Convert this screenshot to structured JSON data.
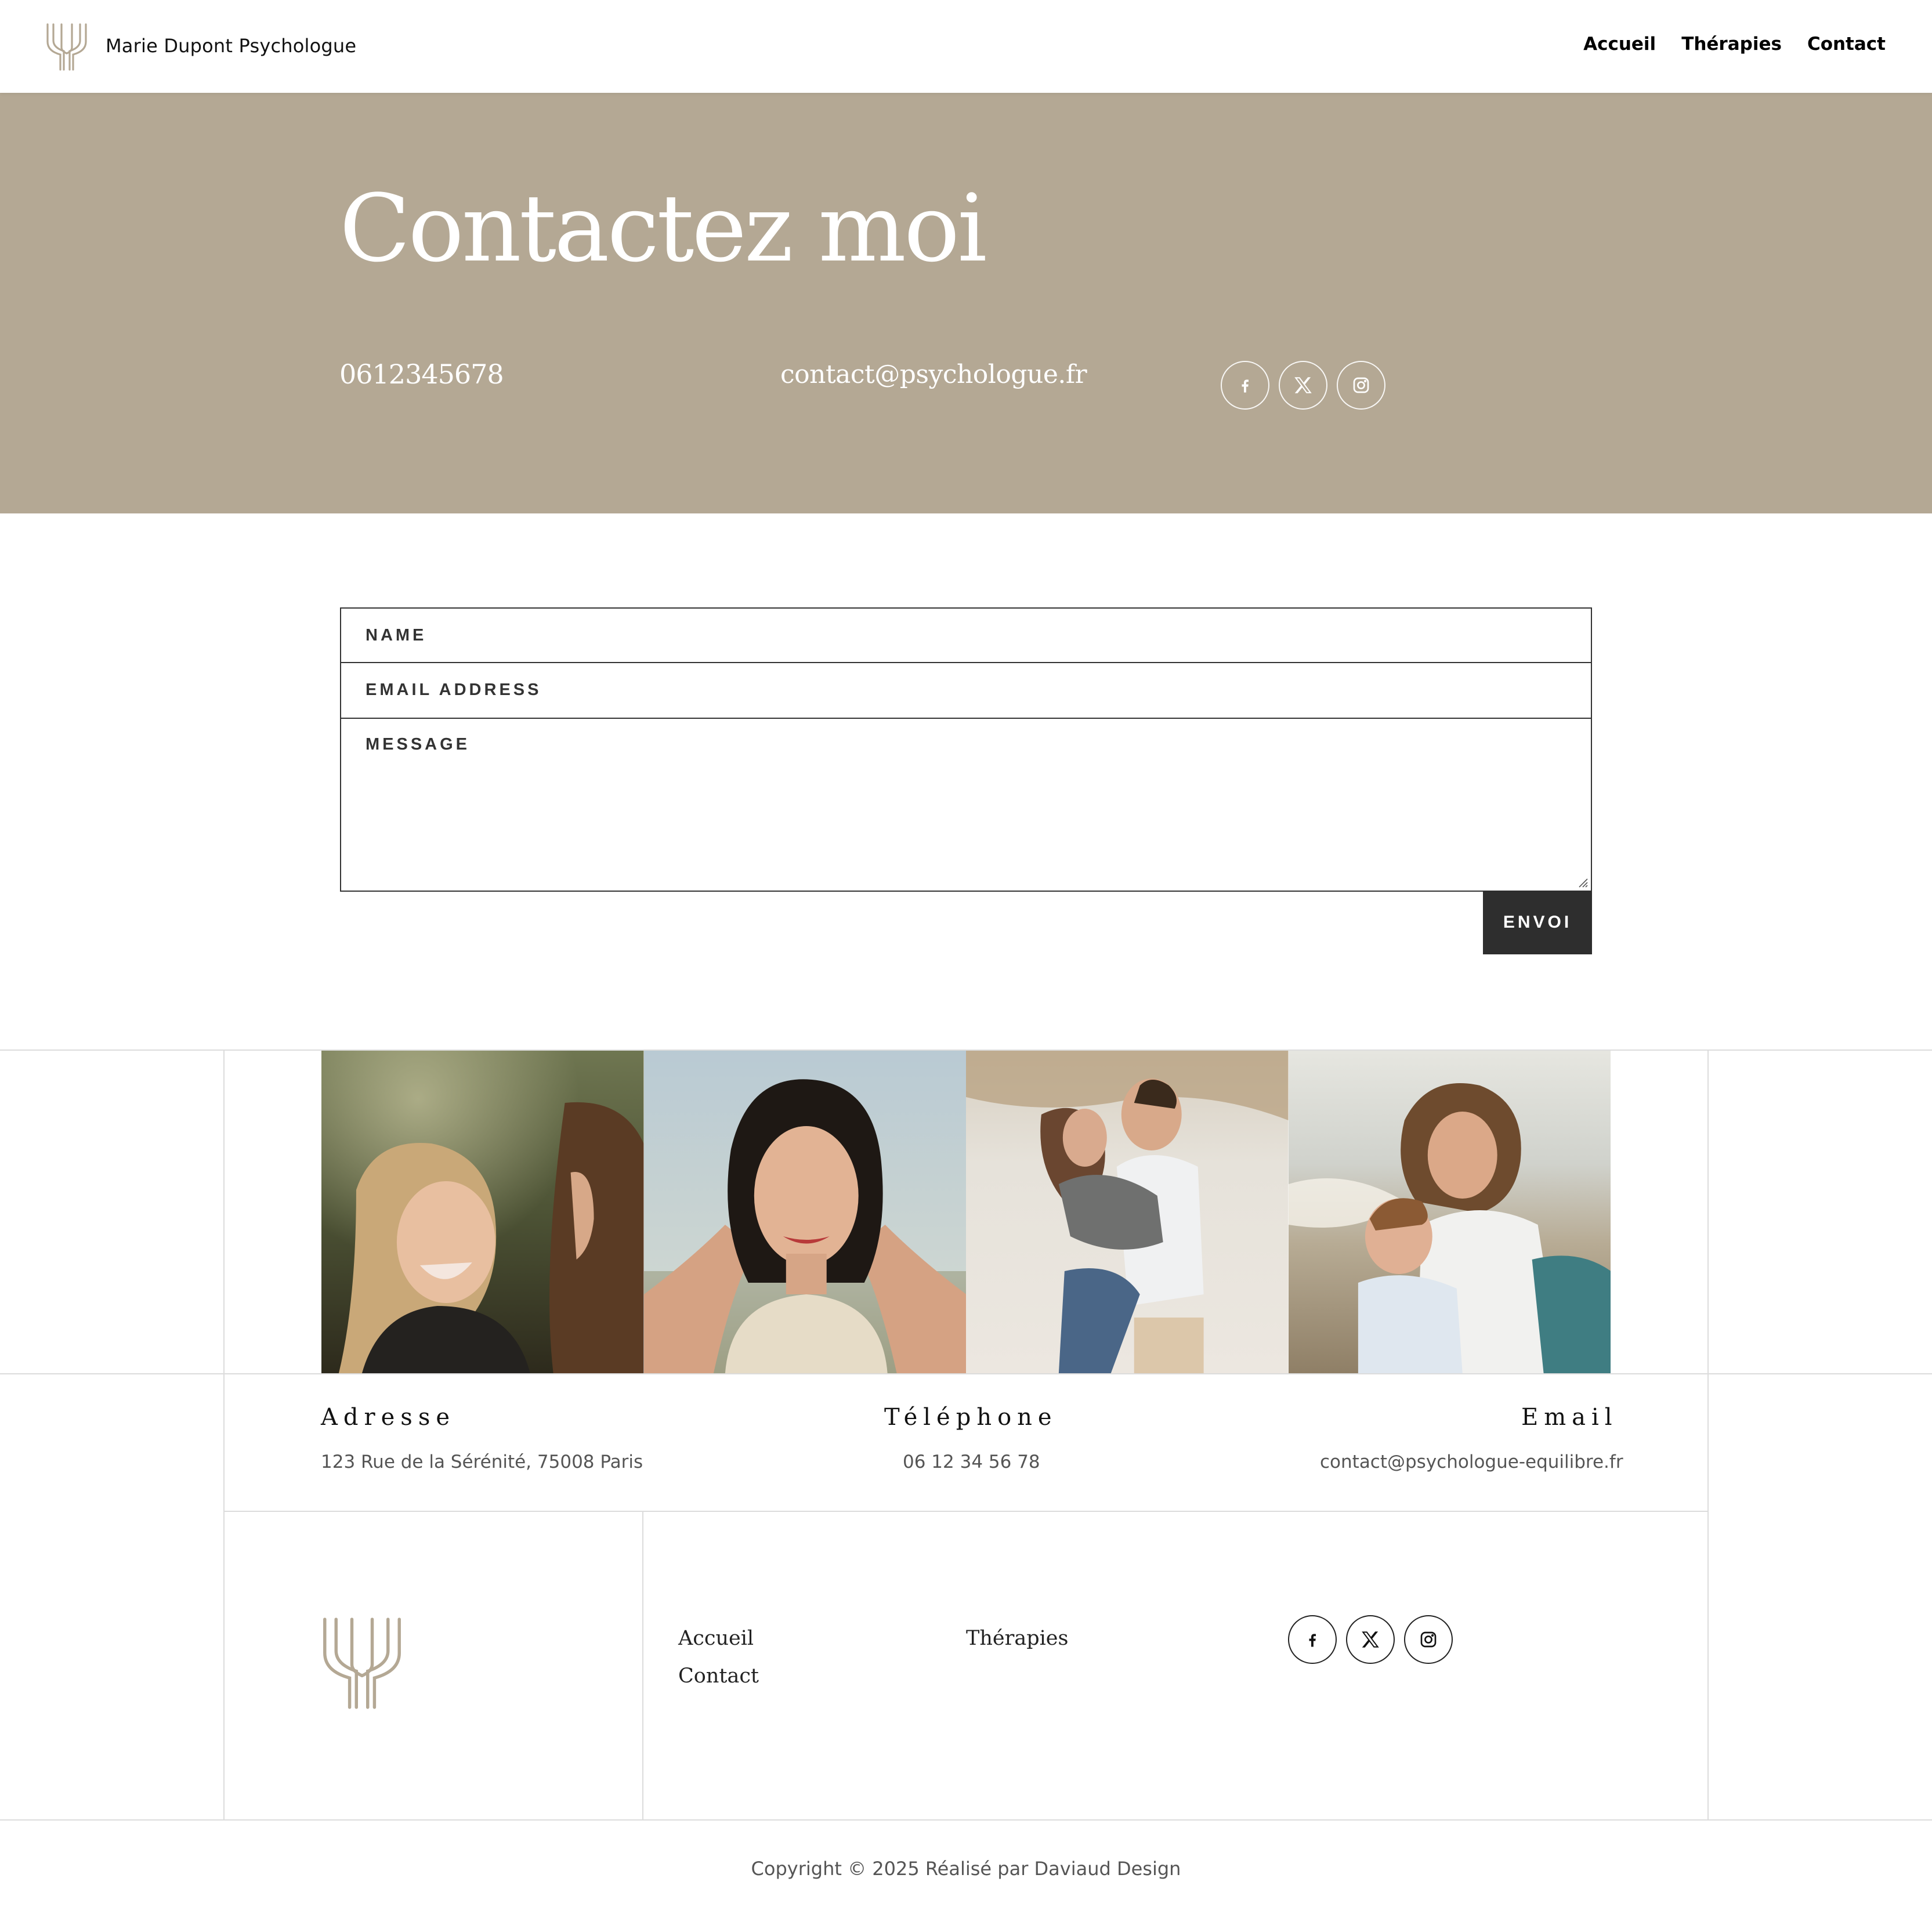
{
  "header": {
    "brand": "Marie Dupont Psychologue",
    "logo_icon": "trident-tree-icon",
    "nav": [
      "Accueil",
      "Thérapies",
      "Contact"
    ]
  },
  "hero": {
    "title": "Contactez moi",
    "phone": "0612345678",
    "email": "contact@psychologue.fr",
    "background_color": "#b4a894",
    "social_icons": [
      "facebook-icon",
      "x-twitter-icon",
      "instagram-icon"
    ]
  },
  "form": {
    "name_placeholder": "NAME",
    "email_placeholder": "EMAIL ADDRESS",
    "message_placeholder": "MESSAGE",
    "submit_label": "ENVOI"
  },
  "photos": [
    {
      "alt": "two-women-laughing"
    },
    {
      "alt": "woman-portrait-beach"
    },
    {
      "alt": "couple-embracing-on-beach"
    },
    {
      "alt": "mother-hugging-child-at-seaside"
    }
  ],
  "info": {
    "address_label": "Adresse",
    "address_value": "123 Rue de la Sérénité, 75008 Paris",
    "phone_label": "Téléphone",
    "phone_value": "06 12 34 56 78",
    "email_label": "Email",
    "email_value": "contact@psychologue-equilibre.fr"
  },
  "footer": {
    "nav": [
      "Accueil",
      "Thérapies",
      "Contact"
    ],
    "social_icons": [
      "facebook-icon",
      "x-twitter-icon",
      "instagram-icon"
    ],
    "copyright": "Copyright © 2025 Réalisé par Daviaud Design"
  },
  "colors": {
    "accent": "#b4a894",
    "button": "#2e2e2e",
    "gridline": "#dcdcdc"
  }
}
